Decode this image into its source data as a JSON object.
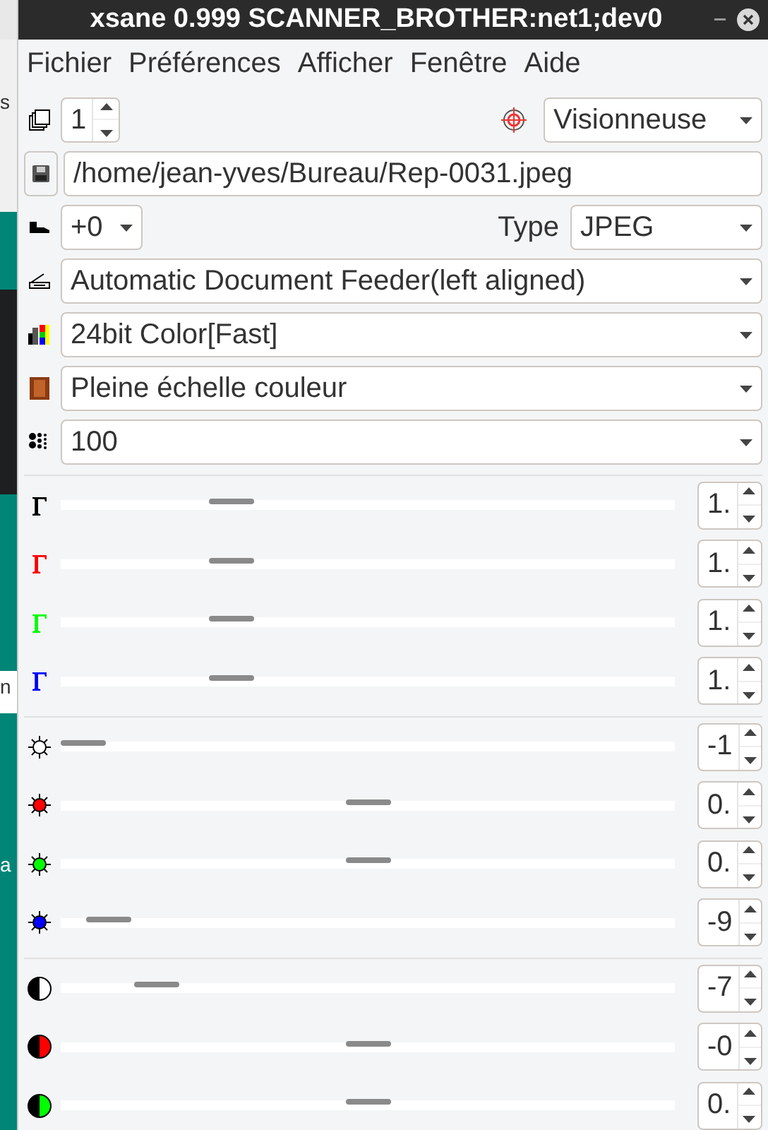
{
  "background_fragments": [
    {
      "text": "s"
    },
    {
      "text": "n"
    },
    {
      "text": "a"
    }
  ],
  "window": {
    "title": "xsane 0.999 SCANNER_BROTHER:net1;dev0"
  },
  "menu": [
    {
      "label": "Fichier"
    },
    {
      "label": "Préférences"
    },
    {
      "label": "Afficher"
    },
    {
      "label": "Fenêtre"
    },
    {
      "label": "Aide"
    }
  ],
  "toolbar": {
    "copies": "1",
    "target": "Visionneuse"
  },
  "filename": {
    "value": "/home/jean-yves/Bureau/Rep-0031.jpeg"
  },
  "rotation": "+0",
  "type_label": "Type",
  "type": "JPEG",
  "selects": [
    {
      "kind": "source",
      "value": "Automatic Document Feeder(left aligned)"
    },
    {
      "kind": "mode",
      "value": "24bit Color[Fast]"
    },
    {
      "kind": "scanmode",
      "value": "Pleine échelle couleur"
    },
    {
      "kind": "resolution",
      "value": "100"
    }
  ],
  "slider_groups": [
    [
      {
        "kind": "gamma",
        "color": "#000000",
        "level": 0.26,
        "reading": "1."
      },
      {
        "kind": "gamma",
        "color": "#ff0000",
        "level": 0.26,
        "reading": "1."
      },
      {
        "kind": "gamma",
        "color": "#00ff00",
        "level": 0.26,
        "reading": "1."
      },
      {
        "kind": "gamma",
        "color": "#0000ff",
        "level": 0.26,
        "reading": "1."
      }
    ],
    [
      {
        "kind": "brightness",
        "color": "#ffffff",
        "level": 0,
        "reading": "-1"
      },
      {
        "kind": "brightness",
        "color": "#ff0000",
        "level": 0.5,
        "reading": "0."
      },
      {
        "kind": "brightness",
        "color": "#00ff00",
        "level": 0.5,
        "reading": "0."
      },
      {
        "kind": "brightness",
        "color": "#0000ff",
        "level": 0.045,
        "reading": "-9"
      }
    ],
    [
      {
        "kind": "contrast",
        "color": "#ffffff",
        "level": 0.13,
        "reading": "-7"
      },
      {
        "kind": "contrast",
        "color": "#ff0000",
        "level": 0.5,
        "reading": "-0"
      },
      {
        "kind": "contrast",
        "color": "#00ff00",
        "level": 0.5,
        "reading": "0."
      }
    ]
  ]
}
